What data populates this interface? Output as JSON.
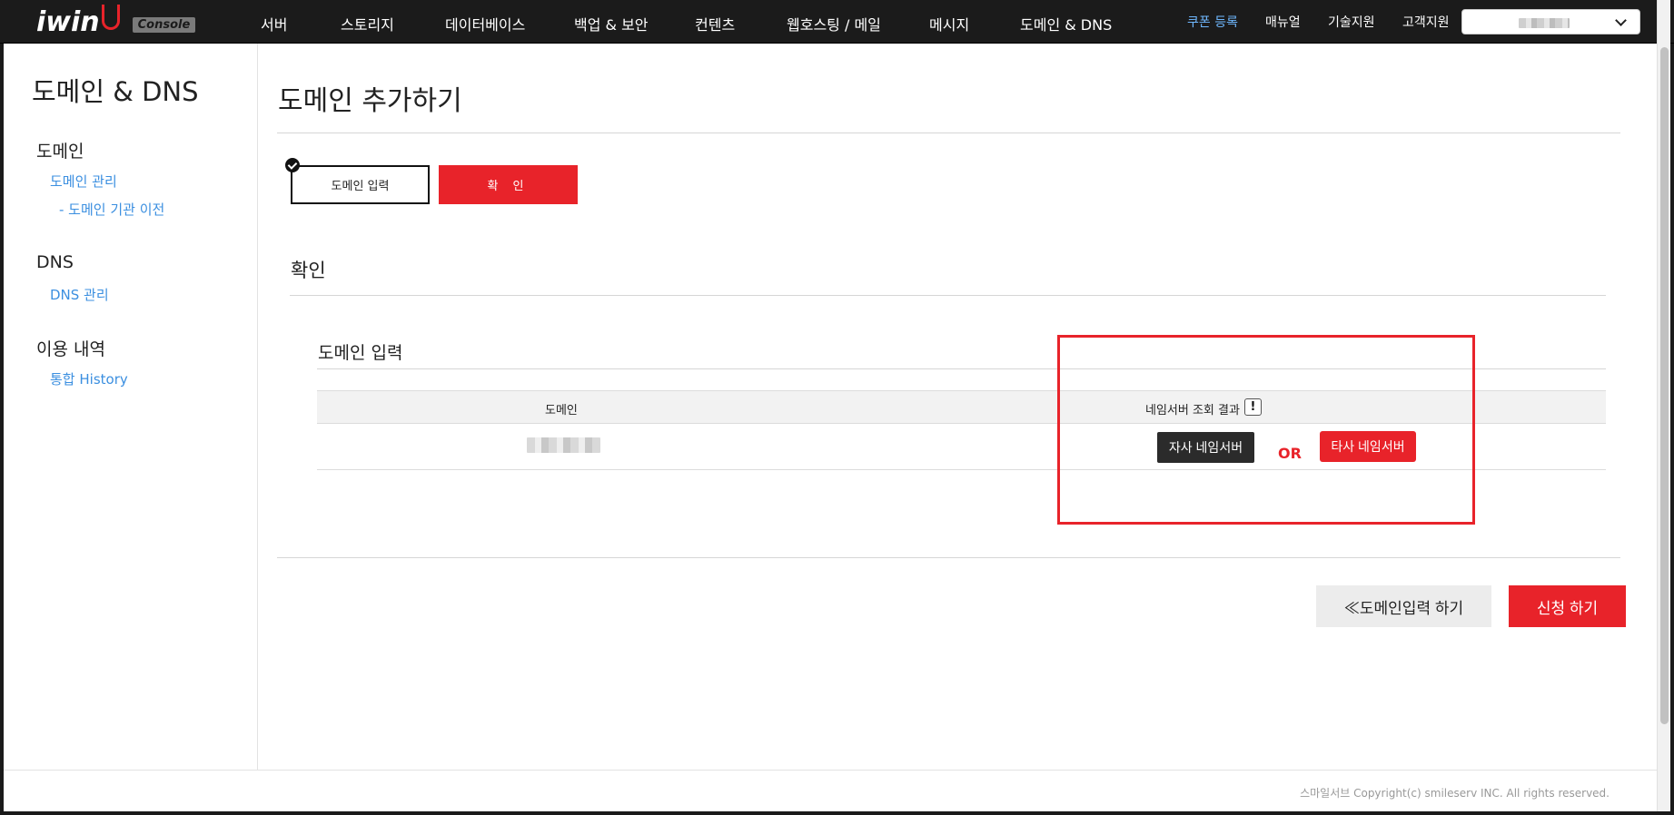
{
  "brand": {
    "logo": "iwin",
    "badge": "Console"
  },
  "topnav": {
    "menu": [
      "서버",
      "스토리지",
      "데이터베이스",
      "백업 & 보안",
      "컨텐츠",
      "웹호스팅 / 메일",
      "메시지",
      "도메인 & DNS"
    ],
    "utilities": [
      "쿠폰 등록",
      "매뉴얼",
      "기술지원",
      "고객지원"
    ]
  },
  "sidebar": {
    "title": "도메인 & DNS",
    "sections": [
      {
        "label": "도메인",
        "links": [
          "도메인 관리",
          "- 도메인 기관 이전"
        ]
      },
      {
        "label": "DNS",
        "links": [
          "DNS 관리"
        ]
      },
      {
        "label": "이용 내역",
        "links": [
          "통합 History"
        ]
      }
    ]
  },
  "main": {
    "title": "도메인 추가하기",
    "steps": [
      "도메인 입력",
      "확 인"
    ],
    "section_title": "확인",
    "sub_title": "도메인 입력",
    "table": {
      "headers": [
        "도메인",
        "네임서버 조회 결과"
      ],
      "info_icon": "!"
    },
    "own_ns_button": "자사 네임서버",
    "or_label": "OR",
    "other_ns_button": "타사 네임서버",
    "back_button": "≪도메인입력 하기",
    "submit_button": "신청 하기"
  },
  "footer": {
    "copyright": "스마일서브 Copyright(c) smileserv INC. All rights reserved."
  },
  "colors": {
    "accent": "#e8232a",
    "link": "#3b8fe0",
    "nav_bg": "#1b1b1b"
  }
}
